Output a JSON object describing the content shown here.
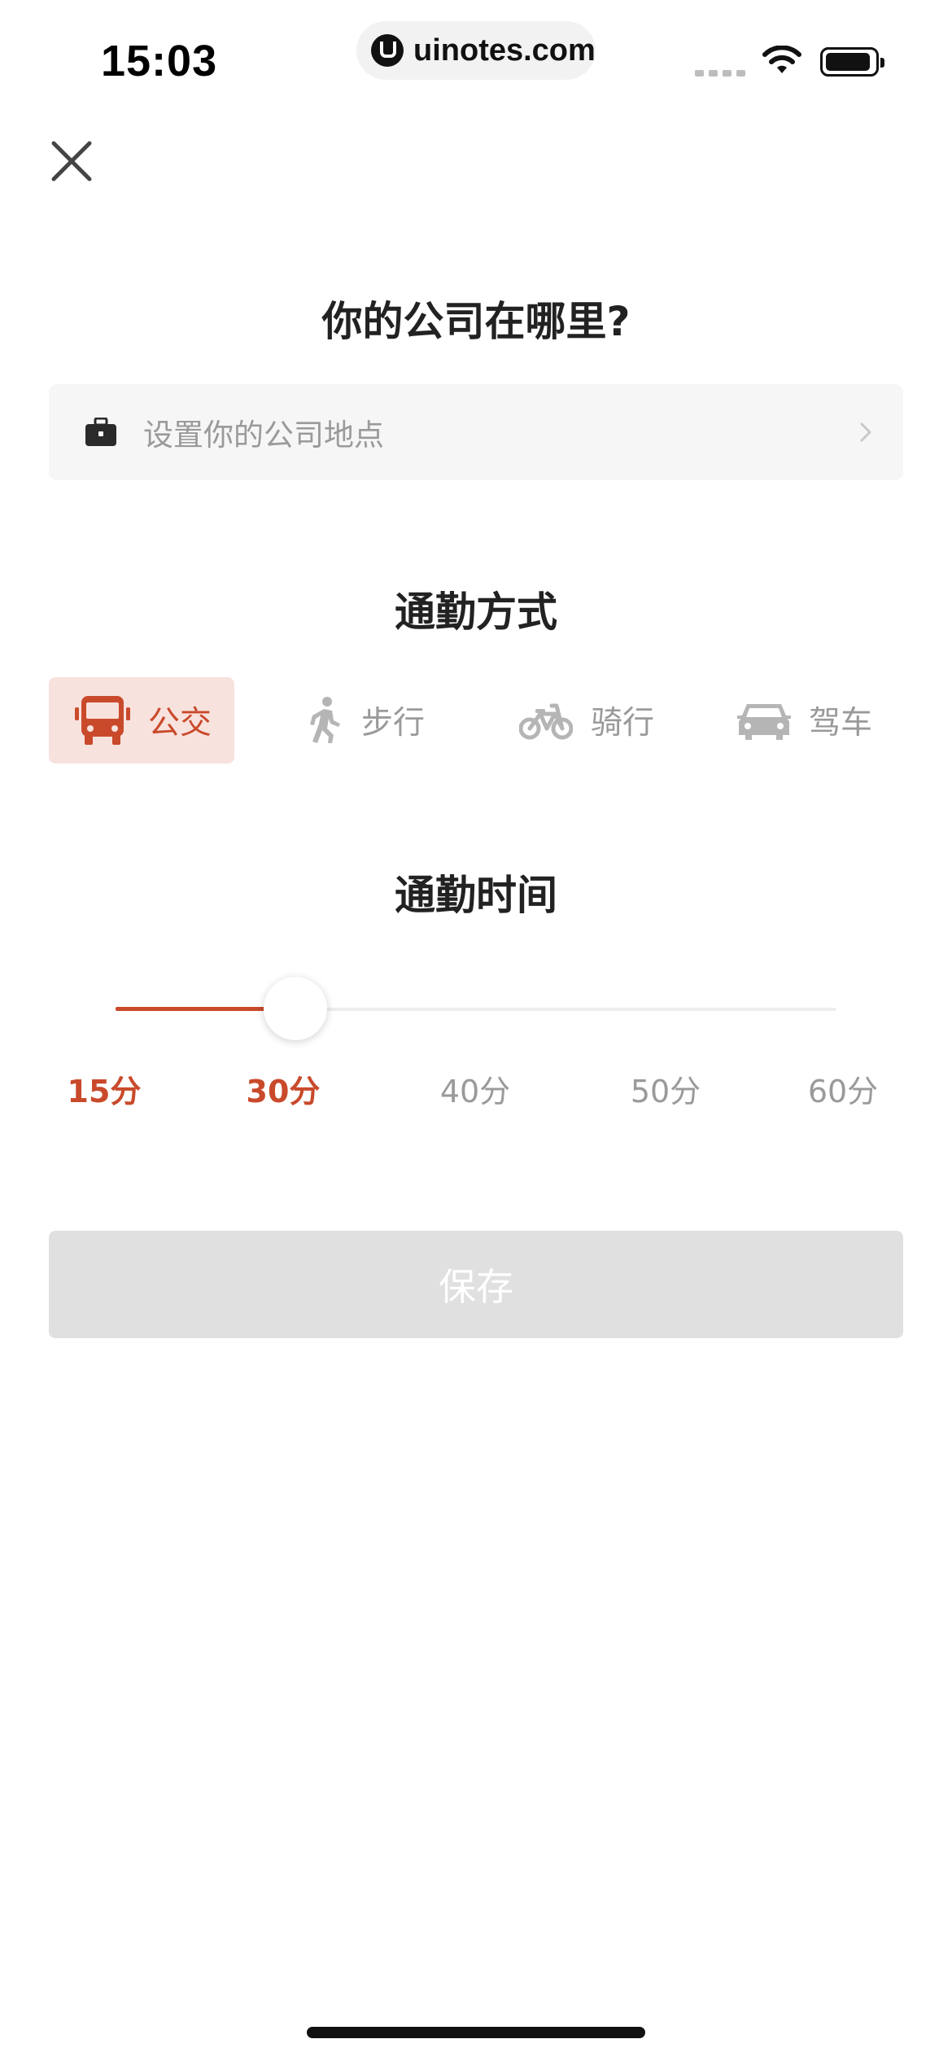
{
  "status_bar": {
    "time": "15:03",
    "url": "uinotes.com"
  },
  "header": {
    "close_icon": "close-icon"
  },
  "company": {
    "title": "你的公司在哪里?",
    "placeholder": "设置你的公司地点",
    "icon": "briefcase-icon"
  },
  "commute_mode": {
    "title": "通勤方式",
    "options": [
      {
        "label": "公交",
        "icon": "bus-icon",
        "selected": true
      },
      {
        "label": "步行",
        "icon": "walk-icon",
        "selected": false
      },
      {
        "label": "骑行",
        "icon": "bicycle-icon",
        "selected": false
      },
      {
        "label": "驾车",
        "icon": "car-icon",
        "selected": false
      }
    ]
  },
  "commute_time": {
    "title": "通勤时间",
    "ticks": [
      "15分",
      "30分",
      "40分",
      "50分",
      "60分"
    ],
    "selected": "30分"
  },
  "save": {
    "label": "保存",
    "enabled": false
  },
  "colors": {
    "accent": "#c94a2b",
    "accent_bg": "#f8e2de",
    "disabled": "#e0e0e0",
    "muted": "#9a9a9a"
  }
}
